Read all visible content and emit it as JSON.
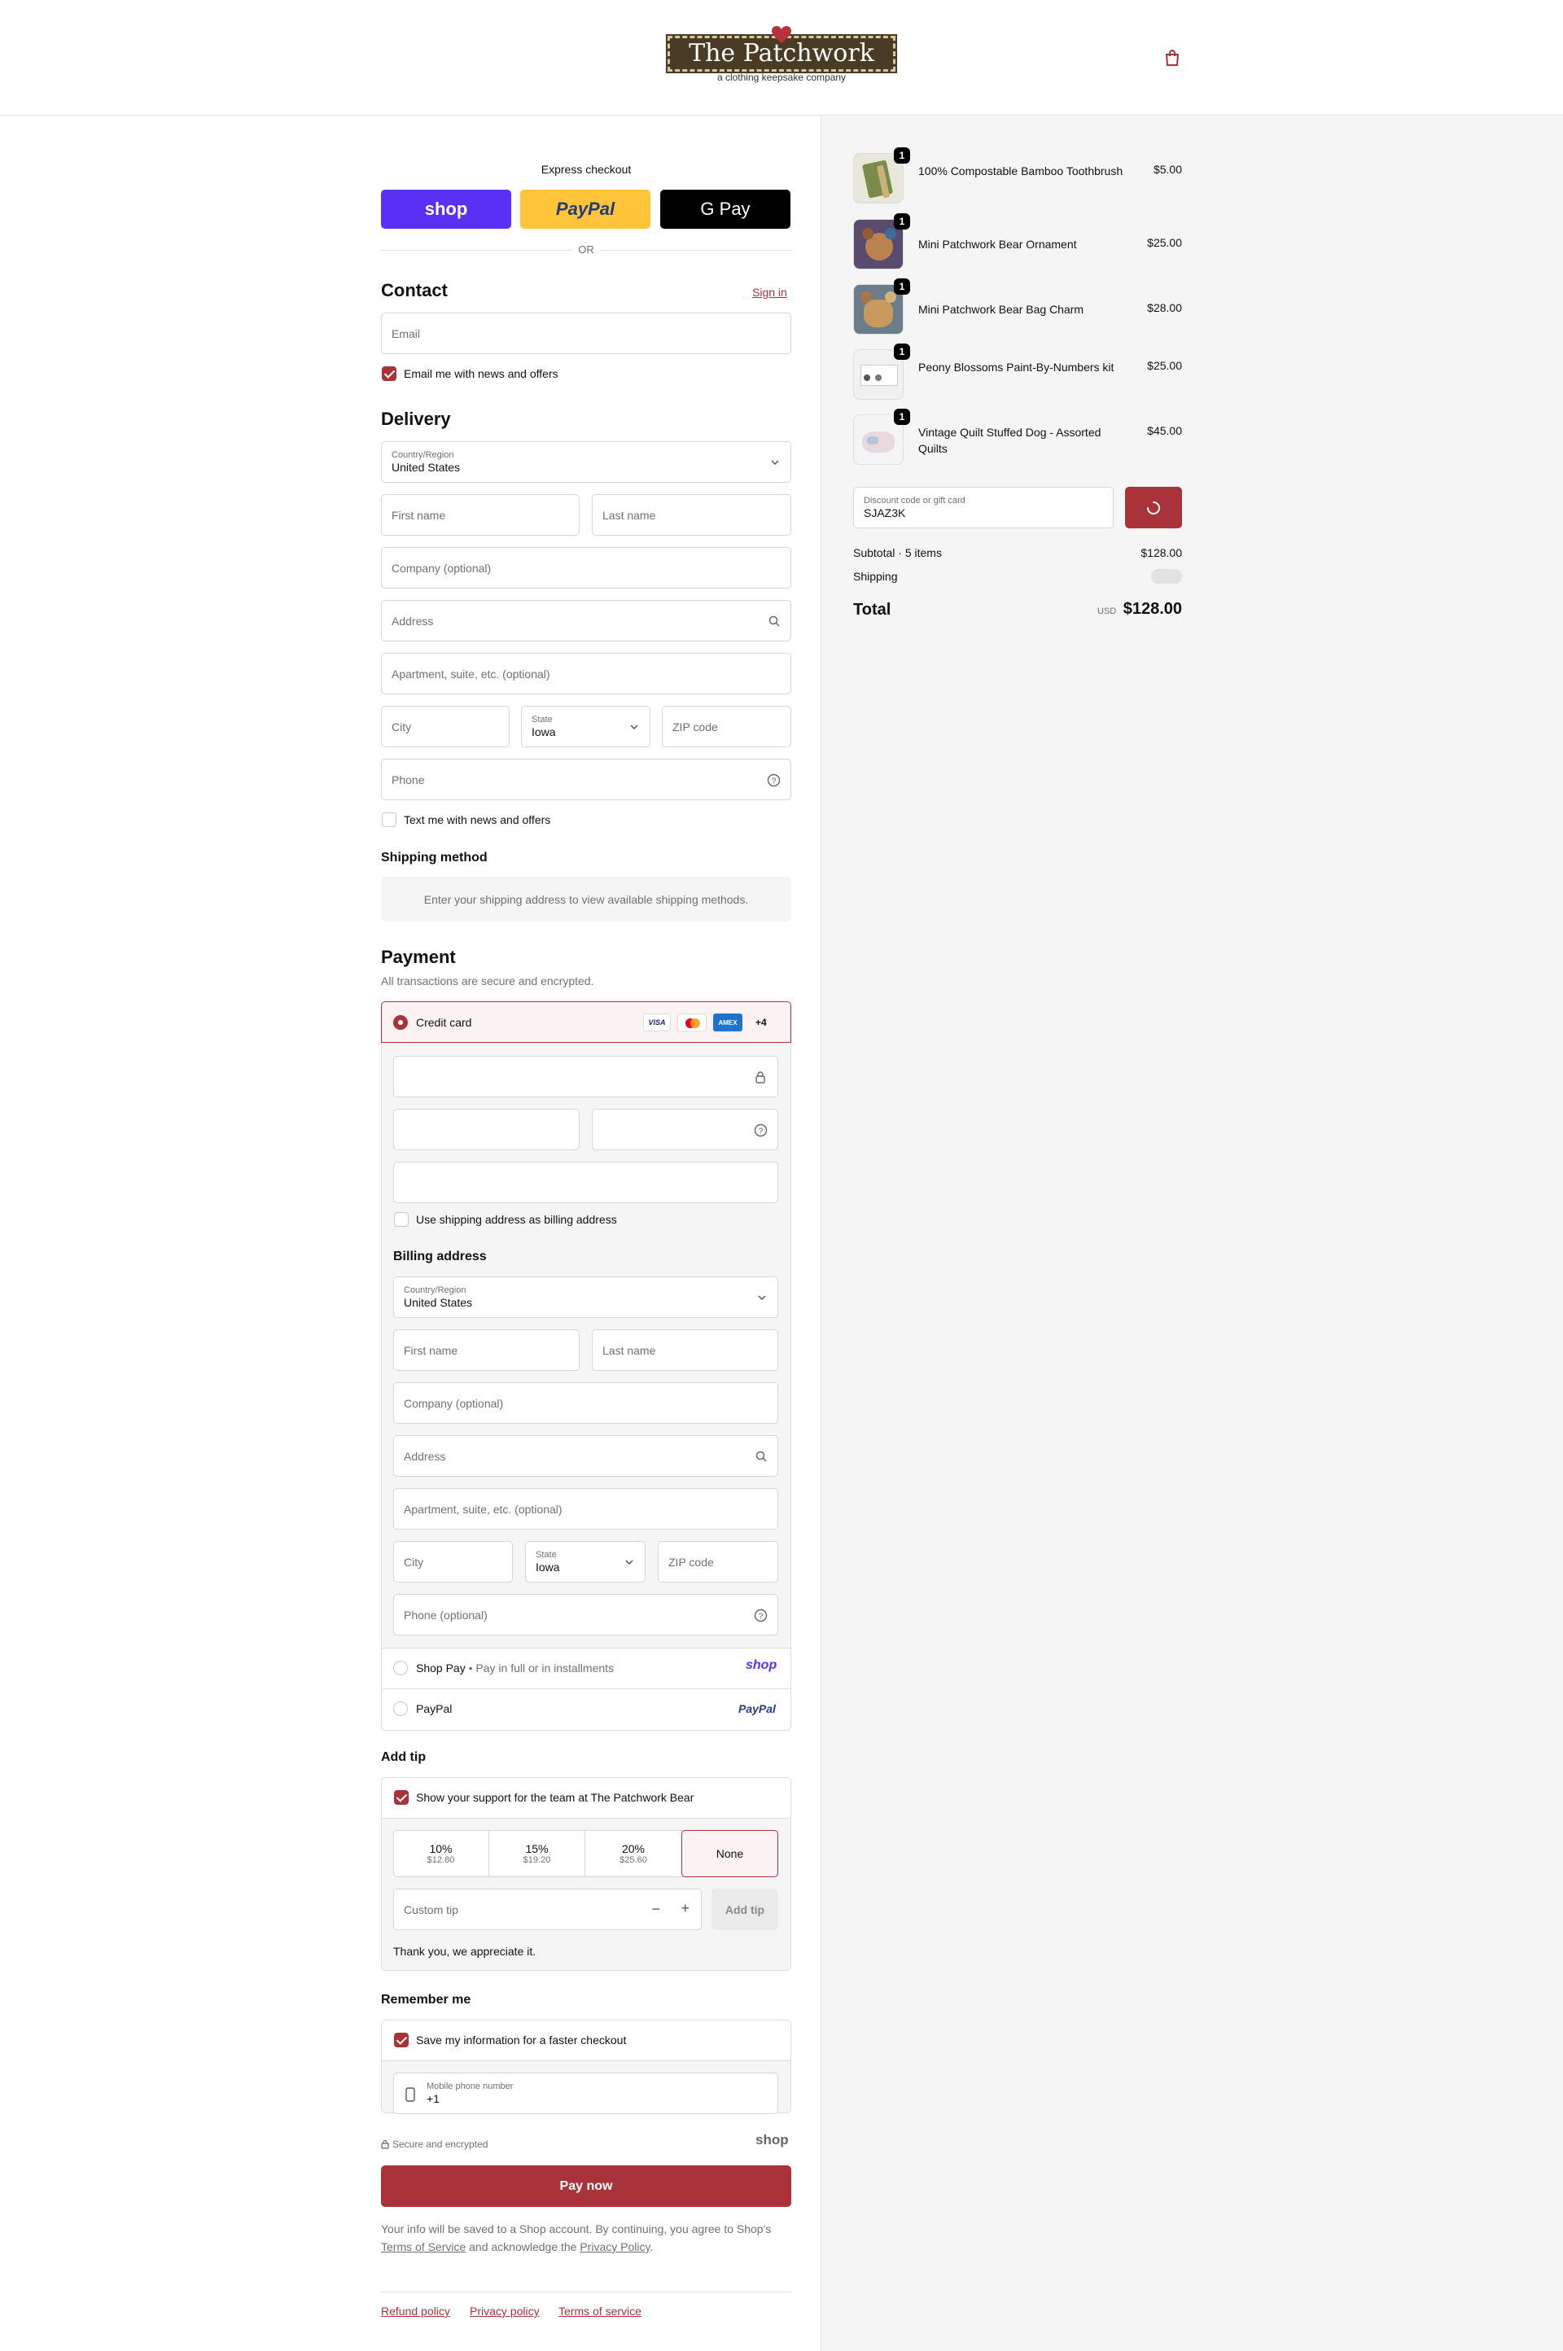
{
  "header": {
    "logo_title": "The Patchwork Bear",
    "logo_tagline": "a clothing keepsake company",
    "cart_icon": "shopping-bag-icon"
  },
  "express": {
    "label": "Express checkout",
    "shop_label": "shop",
    "paypal_label": "PayPal",
    "gpay_label": "G Pay",
    "or_label": "OR"
  },
  "contact": {
    "heading": "Contact",
    "sign_in": "Sign in",
    "email_placeholder": "Email",
    "news_label": "Email me with news and offers",
    "news_checked": true
  },
  "delivery": {
    "heading": "Delivery",
    "country_label": "Country/Region",
    "country_value": "United States",
    "first_name": "First name",
    "last_name": "Last name",
    "company": "Company (optional)",
    "address": "Address",
    "apartment": "Apartment, suite, etc. (optional)",
    "city": "City",
    "state_label": "State",
    "state_value": "Iowa",
    "zip": "ZIP code",
    "phone": "Phone",
    "text_news_label": "Text me with news and offers"
  },
  "shipping": {
    "heading": "Shipping method",
    "message": "Enter your shipping address to view available shipping methods."
  },
  "payment": {
    "heading": "Payment",
    "subtitle": "All transactions are secure and encrypted.",
    "credit_card_label": "Credit card",
    "card_brands": [
      "VISA",
      "mastercard",
      "AMEX"
    ],
    "more_brands": "+4",
    "use_shipping_label": "Use shipping address as billing address",
    "billing_heading": "Billing address",
    "billing": {
      "country_label": "Country/Region",
      "country_value": "United States",
      "first_name": "First name",
      "last_name": "Last name",
      "company": "Company (optional)",
      "address": "Address",
      "apartment": "Apartment, suite, etc. (optional)",
      "city": "City",
      "state_label": "State",
      "state_value": "Iowa",
      "zip": "ZIP code",
      "phone": "Phone (optional)"
    },
    "shop_pay_label": "Shop Pay",
    "shop_pay_sub": "Pay in full or in installments",
    "shop_pay_logo": "shop",
    "paypal_label": "PayPal",
    "paypal_logo": "PayPal"
  },
  "tip": {
    "heading": "Add tip",
    "support_label": "Show your support for the team at The Patchwork Bear",
    "options": [
      {
        "pct": "10%",
        "amt": "$12.80"
      },
      {
        "pct": "15%",
        "amt": "$19.20"
      },
      {
        "pct": "20%",
        "amt": "$25.60"
      },
      {
        "pct": "None",
        "amt": ""
      }
    ],
    "selected": "None",
    "custom_placeholder": "Custom tip",
    "add_button": "Add tip",
    "thanks": "Thank you, we appreciate it."
  },
  "remember": {
    "heading": "Remember me",
    "save_label": "Save my information for a faster checkout",
    "phone_label": "Mobile phone number",
    "phone_value": "+1",
    "secure_label": "Secure and encrypted",
    "shop_logo": "shop"
  },
  "pay_button": "Pay now",
  "legal": {
    "text_before": "Your info will be saved to a Shop account. By continuing, you agree to Shop's",
    "terms_link": "Terms of Service",
    "text_middle": "and acknowledge the",
    "privacy_link": "Privacy Policy",
    "text_end": "."
  },
  "footer": {
    "refund": "Refund policy",
    "privacy": "Privacy policy",
    "terms": "Terms of service"
  },
  "summary": {
    "items": [
      {
        "name": "100% Compostable Bamboo Toothbrush",
        "qty": "1",
        "price": "$5.00"
      },
      {
        "name": "Mini Patchwork Bear Ornament",
        "qty": "1",
        "price": "$25.00"
      },
      {
        "name": "Mini Patchwork Bear Bag Charm",
        "qty": "1",
        "price": "$28.00"
      },
      {
        "name": "Peony Blossoms Paint-By-Numbers kit",
        "qty": "1",
        "price": "$25.00"
      },
      {
        "name": "Vintage Quilt Stuffed Dog - Assorted Quilts",
        "qty": "1",
        "price": "$45.00"
      }
    ],
    "discount_label": "Discount code or gift card",
    "discount_value": "SJAZ3K",
    "subtotal_label": "Subtotal · 5 items",
    "subtotal_value": "$128.00",
    "shipping_label": "Shipping",
    "total_label": "Total",
    "currency": "USD",
    "total_value": "$128.00"
  },
  "colors": {
    "accent": "#a8333b",
    "shop_purple": "#5a31f4",
    "paypal_yellow": "#ffc439"
  }
}
